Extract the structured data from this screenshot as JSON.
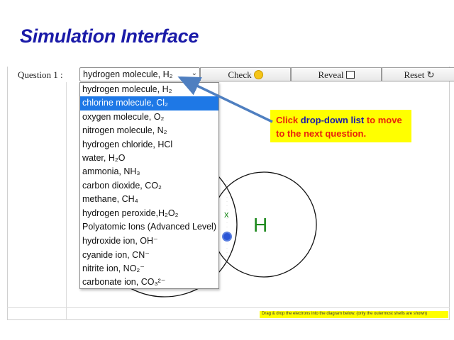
{
  "page_title": "Simulation Interface",
  "toolbar": {
    "question_label": "Question 1 :",
    "selected_value": "hydrogen molecule, H₂",
    "check_label": "Check",
    "reveal_label": "Reveal",
    "reset_label": "Reset ↻"
  },
  "dropdown": {
    "options": [
      "hydrogen molecule, H₂",
      "chlorine molecule, Cl₂",
      "oxygen molecule, O₂",
      "nitrogen molecule, N₂",
      "hydrogen chloride, HCl",
      "water, H₂O",
      "ammonia, NH₃",
      "carbon dioxide, CO₂",
      "methane, CH₄",
      "hydrogen peroxide,H₂O₂",
      "Polyatomic Ions (Advanced Level)",
      "hydroxide ion, OH⁻",
      "cyanide ion, CN⁻",
      "nitrite ion, NO₂⁻",
      "carbonate ion, CO₃²⁻"
    ],
    "highlighted_index": 1
  },
  "callout": {
    "part1": "Click ",
    "part2": "drop-down list",
    "part3": " to move to the next question."
  },
  "diagram": {
    "atom_label": "H",
    "cross_label": "x"
  },
  "hint": "Drag & drop the electrons into the diagram below. (only the outermost shells are shown)",
  "colors": {
    "title": "#1a1aa8",
    "highlight": "#1e78e6",
    "callout_bg": "#ffff00",
    "callout_text": "#e8220c",
    "arrow": "#4f7fc0",
    "atom_label": "#1f8a1f",
    "electron": "#2b55d6"
  }
}
